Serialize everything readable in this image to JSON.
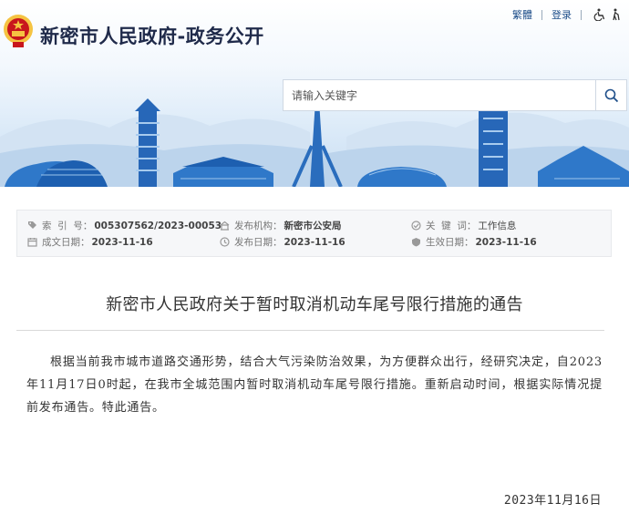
{
  "header": {
    "site_title": "新密市人民政府-政务公开",
    "links": {
      "traditional": "繁體",
      "login": "登录"
    },
    "search": {
      "placeholder": "请输入关键字"
    }
  },
  "meta": {
    "index_label": "索  引  号：",
    "index_value": "005307562/2023-00053",
    "org_label": "发布机构：",
    "org_value": "新密市公安局",
    "keywords_label": "关  键  词：",
    "keywords_value": "工作信息",
    "created_label": "成文日期：",
    "created_value": "2023-11-16",
    "published_label": "发布日期：",
    "published_value": "2023-11-16",
    "effective_label": "生效日期：",
    "effective_value": "2023-11-16"
  },
  "article": {
    "title": "新密市人民政府关于暂时取消机动车尾号限行措施的通告",
    "body": "根据当前我市城市道路交通形势，结合大气污染防治效果，为方便群众出行，经研究决定，自2023年11月17日0时起，在我市全城范围内暂时取消机动车尾号限行措施。重新启动时间，根据实际情况提前发布通告。特此通告。",
    "date": "2023年11月16日"
  },
  "icons": [
    "national-emblem-icon",
    "accessibility-icon",
    "elder-mode-icon",
    "search-icon",
    "tag-icon",
    "building-icon",
    "keyword-icon",
    "calendar-icon",
    "clock-icon",
    "effective-icon"
  ],
  "colors": {
    "title": "#1f2a4a",
    "link": "#1f4f8a",
    "meta_bg": "#f6f7f9",
    "emblem_red": "#c8161d",
    "emblem_gold": "#f5c342"
  }
}
